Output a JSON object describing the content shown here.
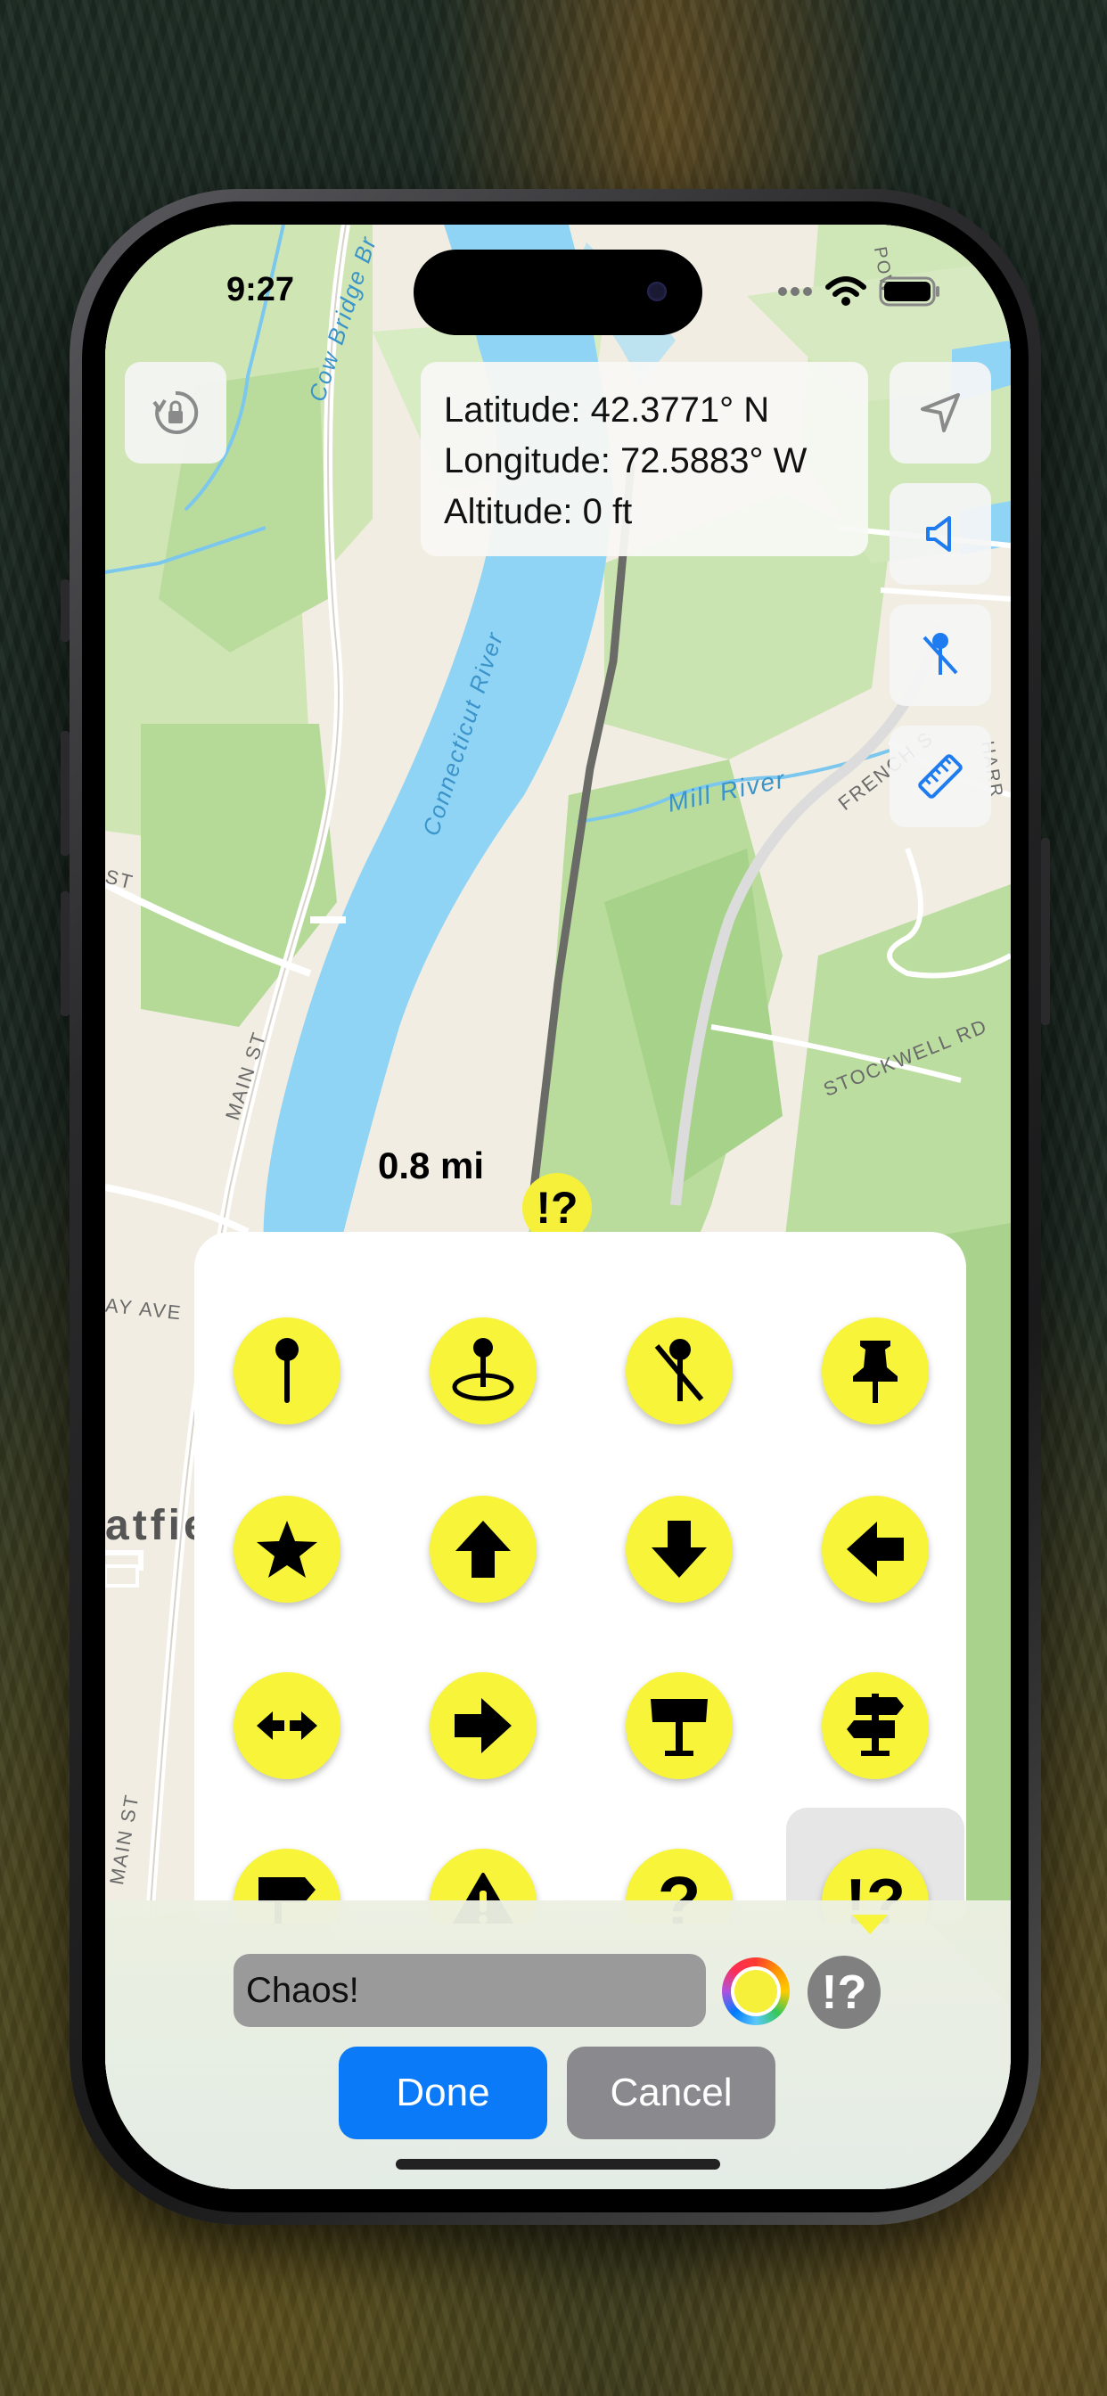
{
  "status_bar": {
    "time": "9:27"
  },
  "coordinates": {
    "latitude": "Latitude: 42.3771° N",
    "longitude": "Longitude: 72.5883° W",
    "altitude": "Altitude: 0 ft"
  },
  "map": {
    "distance_label": "0.8 mi",
    "marker_symbol": "!?",
    "labels": {
      "river": "Connecticut River",
      "mill_river": "Mill River",
      "main_st": "MAIN ST",
      "main_st_2": "MAIN ST",
      "stockwell": "STOCKWELL RD",
      "french": "FRENCH S",
      "st": "ST",
      "ay_ave": "AY AVE",
      "town": "atfie",
      "cow_bridge": "Cow Bridge Br",
      "pow": "POW",
      "harr": "HARR"
    }
  },
  "map_buttons": [
    "rotate-lock-icon",
    "location-arrow-icon",
    "speaker-icon",
    "pin-slash-icon",
    "ruler-icon"
  ],
  "picker_icons": [
    "pin-icon",
    "pin-circle-icon",
    "pin-slash-icon",
    "pushpin-icon",
    "star-icon",
    "arrow-up-icon",
    "arrow-down-icon",
    "arrow-left-icon",
    "arrow-left-right-icon",
    "arrow-right-icon",
    "signpost-icon",
    "signpost-two-way-icon",
    "signpost-right-icon",
    "warning-icon",
    "question-icon",
    "exclaim-question-icon"
  ],
  "picker_selected": "exclaim-question-icon",
  "picker_symbols": {
    "question": "?",
    "exclaim_question": "!?"
  },
  "editor": {
    "name_value": "Chaos!",
    "selected_symbol": "!?",
    "selected_color": "#f6f03a",
    "done_label": "Done",
    "cancel_label": "Cancel"
  },
  "colors": {
    "accent": "#0a7af8",
    "marker_yellow": "#f6f03a",
    "cancel_gray": "#8a8a8e"
  }
}
